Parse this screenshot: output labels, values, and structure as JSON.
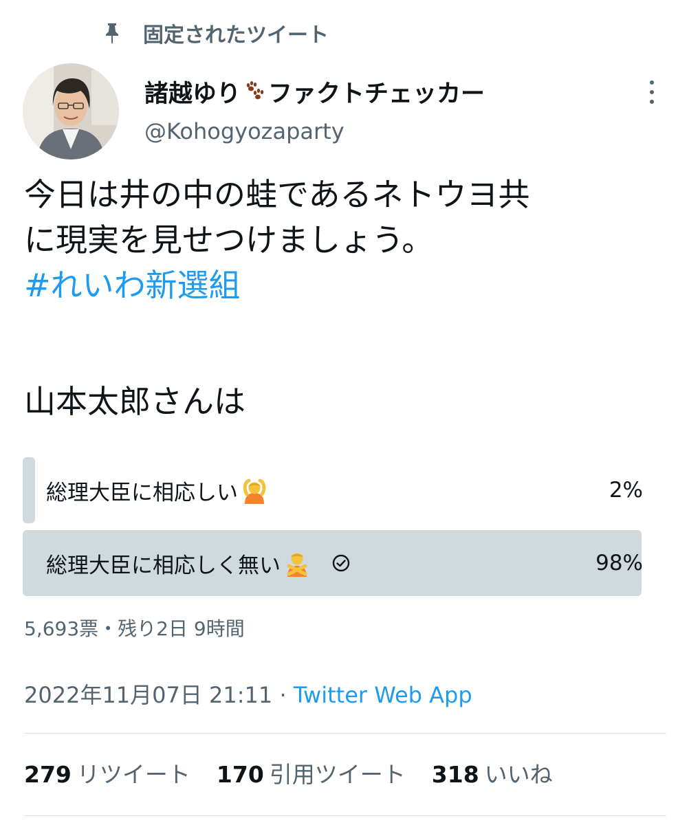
{
  "pinned": {
    "label": "固定されたツイート"
  },
  "author": {
    "name": "諸越ゆり",
    "name_suffix": "ファクトチェッカー",
    "handle": "@Kohogyozaparty"
  },
  "tweet": {
    "lines": [
      "今日は井の中の蛙であるネトウヨ共",
      "に現実を見せつけましょう。"
    ],
    "hashtag": "#れいわ新選組"
  },
  "poll": {
    "question": "山本太郎さんは",
    "options": [
      {
        "label": "総理大臣に相応しい",
        "percent": "2%",
        "share": 0.02,
        "winner": false
      },
      {
        "label": "総理大臣に相応しく無い",
        "percent": "98%",
        "share": 0.98,
        "winner": true
      }
    ],
    "meta": "5,693票・残り2日 9時間"
  },
  "timestamp": {
    "date": "2022年11月07日 21:11",
    "separator": " · ",
    "source": "Twitter Web App"
  },
  "stats": [
    {
      "count": "279",
      "label": "リツイート"
    },
    {
      "count": "170",
      "label": "引用ツイート"
    },
    {
      "count": "318",
      "label": "いいね"
    }
  ],
  "colors": {
    "accent": "#1d9bf0",
    "poll_bar": "#cfd9de",
    "secondary_text": "#536471"
  }
}
